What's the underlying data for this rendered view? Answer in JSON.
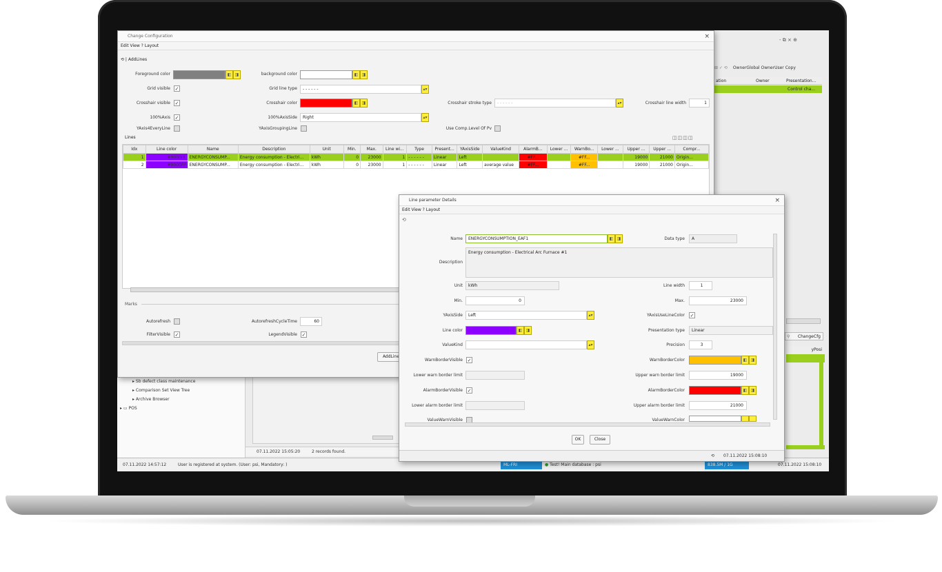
{
  "colors": {
    "selection": "#9ad01d",
    "yellow_button": "#ffef3a",
    "purple": "#8b00ff",
    "red": "#ff0000",
    "orange": "#ffc000",
    "gray": "#808080"
  },
  "bg_app": {
    "title_controls": "- ⧉ × ⊕",
    "toolbar": [
      "OwnerGlobal",
      "OwnerUser",
      "Copy"
    ],
    "grid_headers": [
      "ation",
      "Owner",
      "Presentation..."
    ],
    "grid_row": "Control cha...",
    "right_button": "ChangeCfg",
    "right_col": "yPosi",
    "tree": [
      "Sb defect class maintenance",
      "Comparison Set View Tree",
      "Archive Browser",
      "POS"
    ],
    "status_left": "07.11.2022 14:57:12",
    "status_msg": "User is registered at system. (User: psi, Mandatory: )",
    "status_mid_date": "07.11.2022 15:05:20",
    "status_records": "2 records found.",
    "status_right_date": "07.11.2022 15:08:10",
    "status_db": "Test! Main database : psi",
    "status_chip1": "ML-FRI",
    "status_chip2": "838.5M / 1G"
  },
  "change_cfg": {
    "title": "Change Configuration",
    "menu": "Edit  View  ?  Layout",
    "toolbar_label": "AddLines",
    "fg_label": "Foreground color",
    "bg_label": "background color",
    "grid_visible_label": "Grid visible",
    "grid_line_type_label": "Grid line type",
    "grid_line_type_value": "- - - - - -",
    "crosshair_visible_label": "Crosshair visible",
    "crosshair_color_label": "Crosshair color",
    "crosshair_stroke_label": "Crosshair stroke type",
    "crosshair_stroke_value": "- - - - - -",
    "crosshair_width_label": "Crosshair line width",
    "crosshair_width_value": "1",
    "axis100_label": "100%Axis",
    "axis100side_label": "100%AxisSide",
    "axis100side_value": "Right",
    "yaxis4_label": "YAxis4EveryLine",
    "yaxis_grouping_label": "YAxisGroupingLine",
    "use_comp_label": "Use Comp.Level Of Pv",
    "lines_label": "Lines",
    "marks_label": "Marks",
    "table_headers": [
      "Idx",
      "Line color",
      "Name",
      "Description",
      "Unit",
      "Min.",
      "Max.",
      "Line wi...",
      "Type",
      "Present...",
      "YAxisSide",
      "ValueKind",
      "AlarmB...",
      "Lower ...",
      "WarnBo...",
      "Lower ...",
      "Upper ...",
      "Upper ...",
      "Compr..."
    ],
    "rows": [
      [
        "1",
        "#9900FF",
        "ENERGYCONSUMP...",
        "Energy consumption - Electri...",
        "kWh",
        "0",
        "23000",
        "1",
        "- - - - - -",
        "Linear",
        "Left",
        "",
        "#FF...",
        "",
        "#FF...",
        "",
        "19000",
        "21000",
        "Origin..."
      ],
      [
        "2",
        "#9900FF",
        "ENERGYCONSUMP...",
        "Energy consumption - Electri...",
        "kWh",
        "0",
        "23000",
        "1",
        "- - - - - -",
        "Linear",
        "Left",
        "average value",
        "#FF...",
        "",
        "#FF...",
        "",
        "19000",
        "21000",
        "Origin..."
      ]
    ],
    "autorefresh_label": "Autorefresh",
    "autorefresh_cycle_label": "AutorefreshCycleTime",
    "autorefresh_cycle_value": "60",
    "filter_visible_label": "FilterVisible",
    "legend_visible_label": "LegendVisible",
    "addline_button": "AddLine"
  },
  "line_detail": {
    "title": "Line parameter Details",
    "menu": "Edit  View  ?  Layout",
    "name_label": "Name",
    "name_value": "ENERGYCONSUMPTION_EAF1",
    "datatype_label": "Data type",
    "datatype_value": "A",
    "description_label": "Description",
    "description_value": "Energy consumption - Electrical Arc Furnace #1",
    "unit_label": "Unit",
    "unit_value": "kWh",
    "linewidth_label": "Line width",
    "linewidth_value": "1",
    "min_label": "Min.",
    "min_value": "0",
    "max_label": "Max.",
    "max_value": "23000",
    "yaxisside_label": "YAxisSide",
    "yaxisside_value": "Left",
    "yaxisuse_label": "YAxisUseLineColor",
    "linecolor_label": "Line color",
    "presentation_label": "Presentation type",
    "presentation_value": "Linear",
    "valuekind_label": "ValueKind",
    "precision_label": "Precision",
    "precision_value": "3",
    "warnvisible_label": "WarnBorderVisible",
    "warncolor_label": "WarnBorderColor",
    "lowerwarn_label": "Lower warn border limit",
    "upperwarn_label": "Upper warn border limit",
    "upperwarn_value": "19000",
    "alarmvisible_label": "AlarmBorderVisible",
    "alarmcolor_label": "AlarmBorderColor",
    "loweralarm_label": "Lower alarm border limit",
    "upperalarm_label": "Upper alarm border limit",
    "upperalarm_value": "21000",
    "valuewarnvisible_label": "ValueWarnVisible",
    "valuewarncolor_label": "ValueWarnColor",
    "ok_button": "OK",
    "close_button": "Close",
    "status_date": "07.11.2022 15:08:10"
  }
}
